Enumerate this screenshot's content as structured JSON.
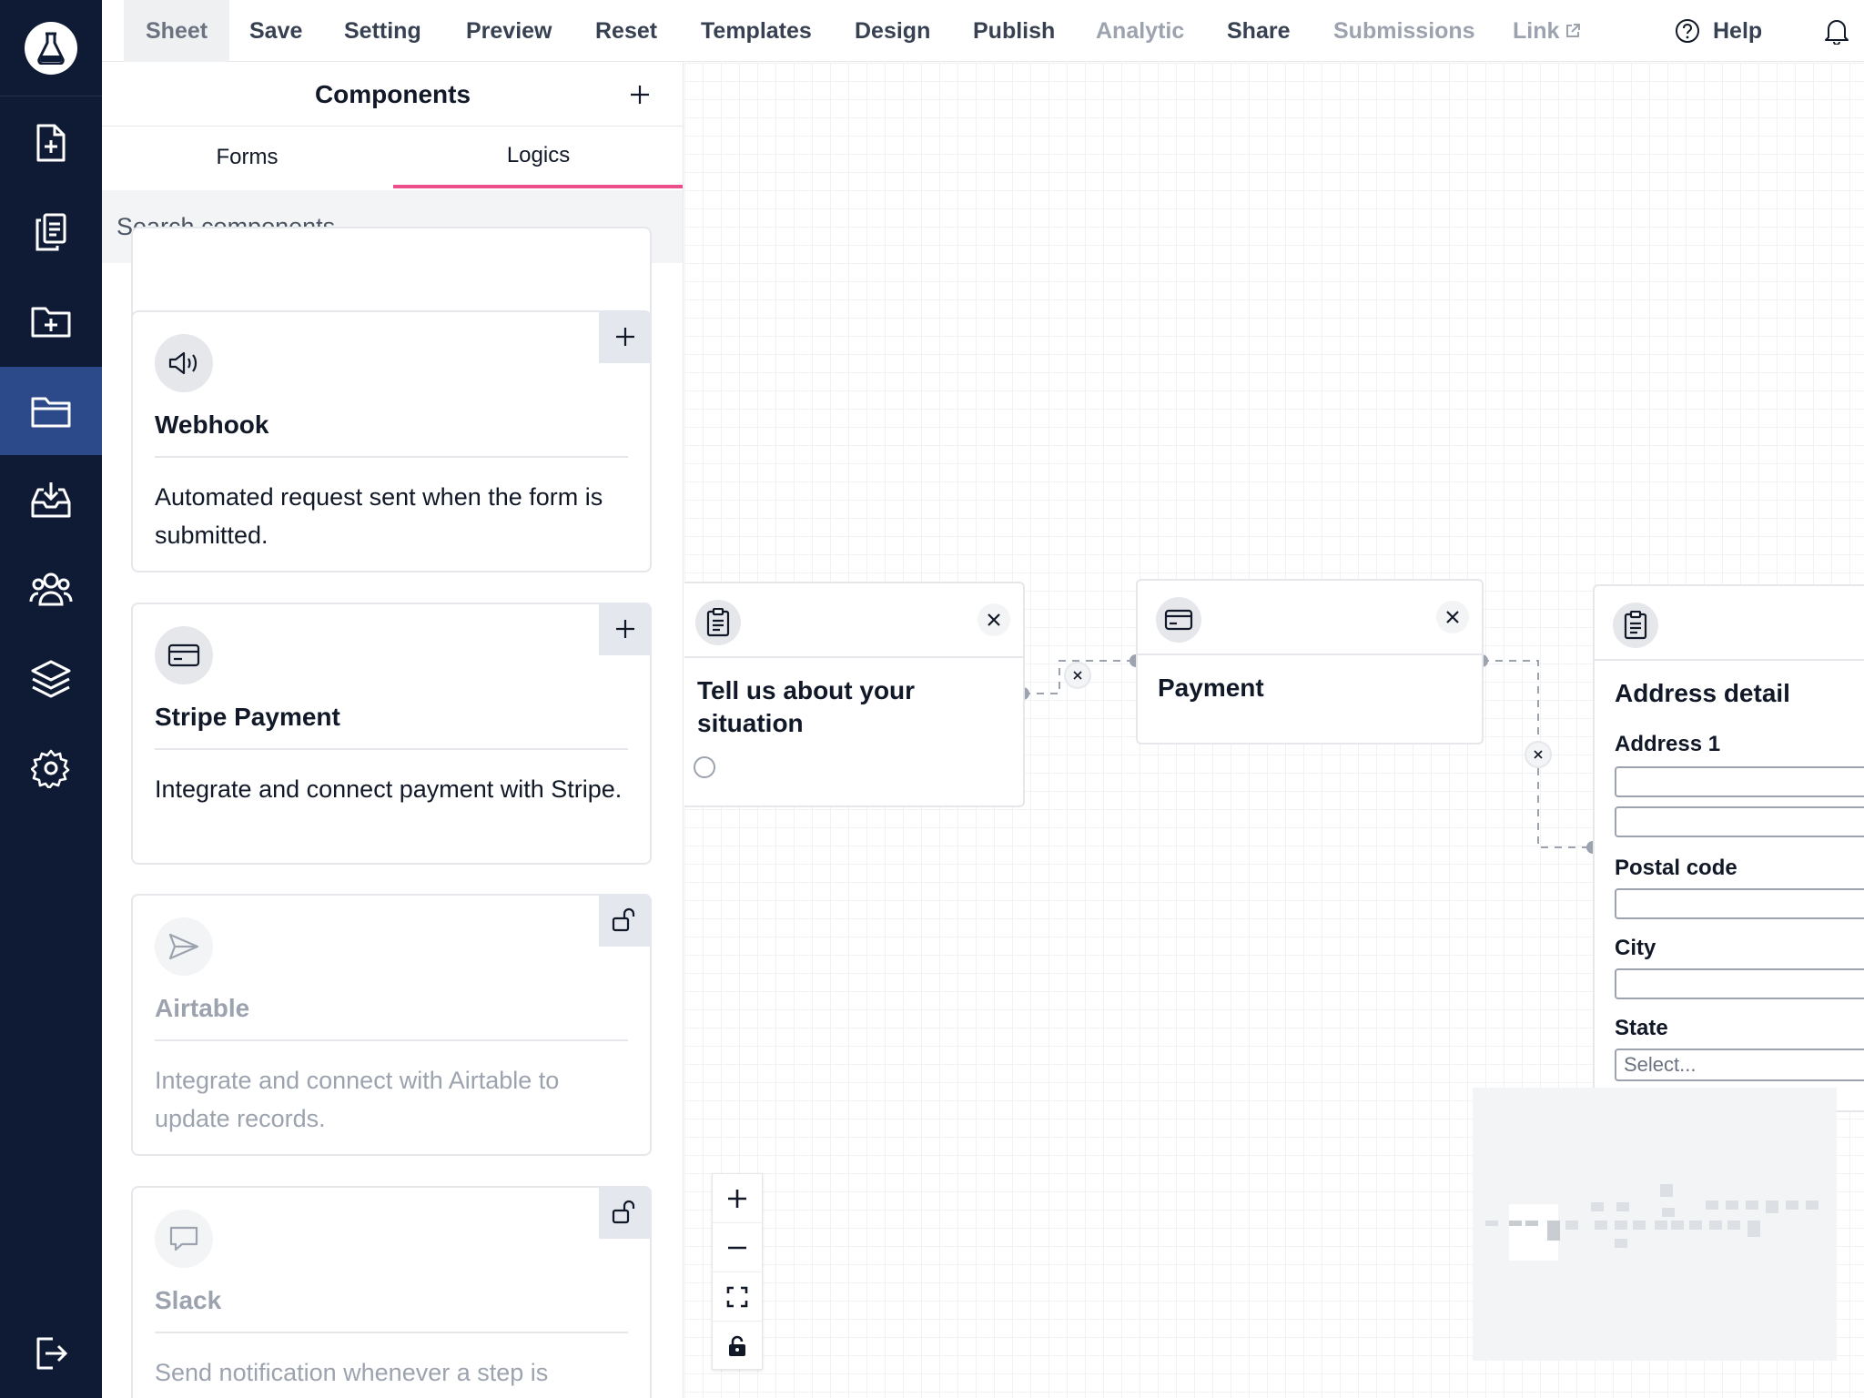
{
  "menu": {
    "sheet": "Sheet",
    "save": "Save",
    "setting": "Setting",
    "preview": "Preview",
    "reset": "Reset",
    "templates": "Templates",
    "design": "Design",
    "publish": "Publish",
    "analytic": "Analytic",
    "share": "Share",
    "submissions": "Submissions",
    "link": "Link",
    "help": "Help"
  },
  "panel": {
    "title": "Components",
    "tabs": [
      {
        "label": "Forms"
      },
      {
        "label": "Logics"
      }
    ],
    "active_tab": "Logics",
    "search_placeholder": "Search components...",
    "cards": [
      {
        "title": "Webhook",
        "description": "Automated request sent when the form is submitted.",
        "icon": "speaker-icon",
        "action": "add"
      },
      {
        "title": "Stripe Payment",
        "description": "Integrate and connect payment with Stripe.",
        "icon": "credit-card-icon",
        "action": "add"
      },
      {
        "title": "Airtable",
        "description": "Integrate and connect with Airtable to update records.",
        "icon": "send-icon",
        "action": "locked"
      },
      {
        "title": "Slack",
        "description": "Send notification whenever a step is",
        "icon": "chat-bubble-icon",
        "action": "locked"
      }
    ]
  },
  "canvas": {
    "nodes": {
      "situation": {
        "title": "Tell us about your situation"
      },
      "payment": {
        "title": "Payment"
      },
      "address": {
        "title": "Address detail",
        "fields": {
          "address1": "Address 1",
          "postal": "Postal code",
          "city": "City",
          "state": "State",
          "state_placeholder": "Select..."
        }
      }
    }
  },
  "colors": {
    "rail": "#0f1b35",
    "rail_active": "#2c4a8a",
    "tab_accent": "#ec4f8a"
  }
}
